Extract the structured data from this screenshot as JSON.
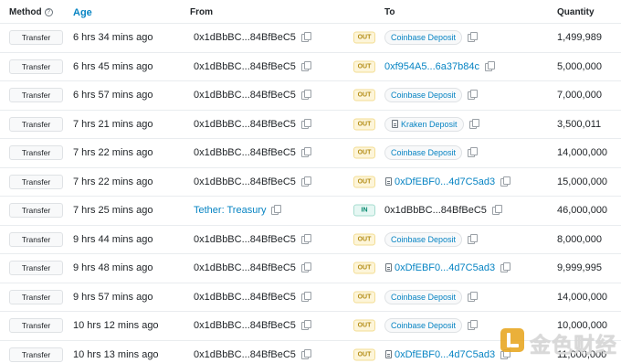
{
  "columns": {
    "method": "Method",
    "age": "Age",
    "from": "From",
    "to": "To",
    "quantity": "Quantity"
  },
  "method_help_icon": "question-circle-icon",
  "rows": [
    {
      "method": "Transfer",
      "age": "6 hrs 34 mins ago",
      "from": "0x1dBbBC...84BfBeC5",
      "from_is_link": false,
      "direction": "OUT",
      "to": "Coinbase Deposit",
      "to_type": "tag",
      "quantity": "1,499,989"
    },
    {
      "method": "Transfer",
      "age": "6 hrs 45 mins ago",
      "from": "0x1dBbBC...84BfBeC5",
      "from_is_link": false,
      "direction": "OUT",
      "to": "0xf954A5...6a37b84c",
      "to_type": "link",
      "quantity": "5,000,000"
    },
    {
      "method": "Transfer",
      "age": "6 hrs 57 mins ago",
      "from": "0x1dBbBC...84BfBeC5",
      "from_is_link": false,
      "direction": "OUT",
      "to": "Coinbase Deposit",
      "to_type": "tag",
      "quantity": "7,000,000"
    },
    {
      "method": "Transfer",
      "age": "7 hrs 21 mins ago",
      "from": "0x1dBbBC...84BfBeC5",
      "from_is_link": false,
      "direction": "OUT",
      "to": "Kraken Deposit",
      "to_type": "tag-contract",
      "quantity": "3,500,011"
    },
    {
      "method": "Transfer",
      "age": "7 hrs 22 mins ago",
      "from": "0x1dBbBC...84BfBeC5",
      "from_is_link": false,
      "direction": "OUT",
      "to": "Coinbase Deposit",
      "to_type": "tag",
      "quantity": "14,000,000"
    },
    {
      "method": "Transfer",
      "age": "7 hrs 22 mins ago",
      "from": "0x1dBbBC...84BfBeC5",
      "from_is_link": false,
      "direction": "OUT",
      "to": "0xDfEBF0...4d7C5ad3",
      "to_type": "link-contract",
      "quantity": "15,000,000"
    },
    {
      "method": "Transfer",
      "age": "7 hrs 25 mins ago",
      "from": "Tether: Treasury",
      "from_is_link": true,
      "direction": "IN",
      "to": "0x1dBbBC...84BfBeC5",
      "to_type": "plain",
      "quantity": "46,000,000"
    },
    {
      "method": "Transfer",
      "age": "9 hrs 44 mins ago",
      "from": "0x1dBbBC...84BfBeC5",
      "from_is_link": false,
      "direction": "OUT",
      "to": "Coinbase Deposit",
      "to_type": "tag",
      "quantity": "8,000,000"
    },
    {
      "method": "Transfer",
      "age": "9 hrs 48 mins ago",
      "from": "0x1dBbBC...84BfBeC5",
      "from_is_link": false,
      "direction": "OUT",
      "to": "0xDfEBF0...4d7C5ad3",
      "to_type": "link-contract",
      "quantity": "9,999,995"
    },
    {
      "method": "Transfer",
      "age": "9 hrs 57 mins ago",
      "from": "0x1dBbBC...84BfBeC5",
      "from_is_link": false,
      "direction": "OUT",
      "to": "Coinbase Deposit",
      "to_type": "tag",
      "quantity": "14,000,000"
    },
    {
      "method": "Transfer",
      "age": "10 hrs 12 mins ago",
      "from": "0x1dBbBC...84BfBeC5",
      "from_is_link": false,
      "direction": "OUT",
      "to": "Coinbase Deposit",
      "to_type": "tag",
      "quantity": "10,000,000"
    },
    {
      "method": "Transfer",
      "age": "10 hrs 13 mins ago",
      "from": "0x1dBbBC...84BfBeC5",
      "from_is_link": false,
      "direction": "OUT",
      "to": "0xDfEBF0...4d7C5ad3",
      "to_type": "link-contract",
      "quantity": "11,000,000"
    }
  ],
  "watermark": {
    "text": "金色财经",
    "logo_icon": "jinse-logo-icon"
  },
  "colors": {
    "link": "#0784c3",
    "out_badge": "#fdf5d9",
    "in_badge": "#e6f7f3",
    "text": "#212529"
  }
}
